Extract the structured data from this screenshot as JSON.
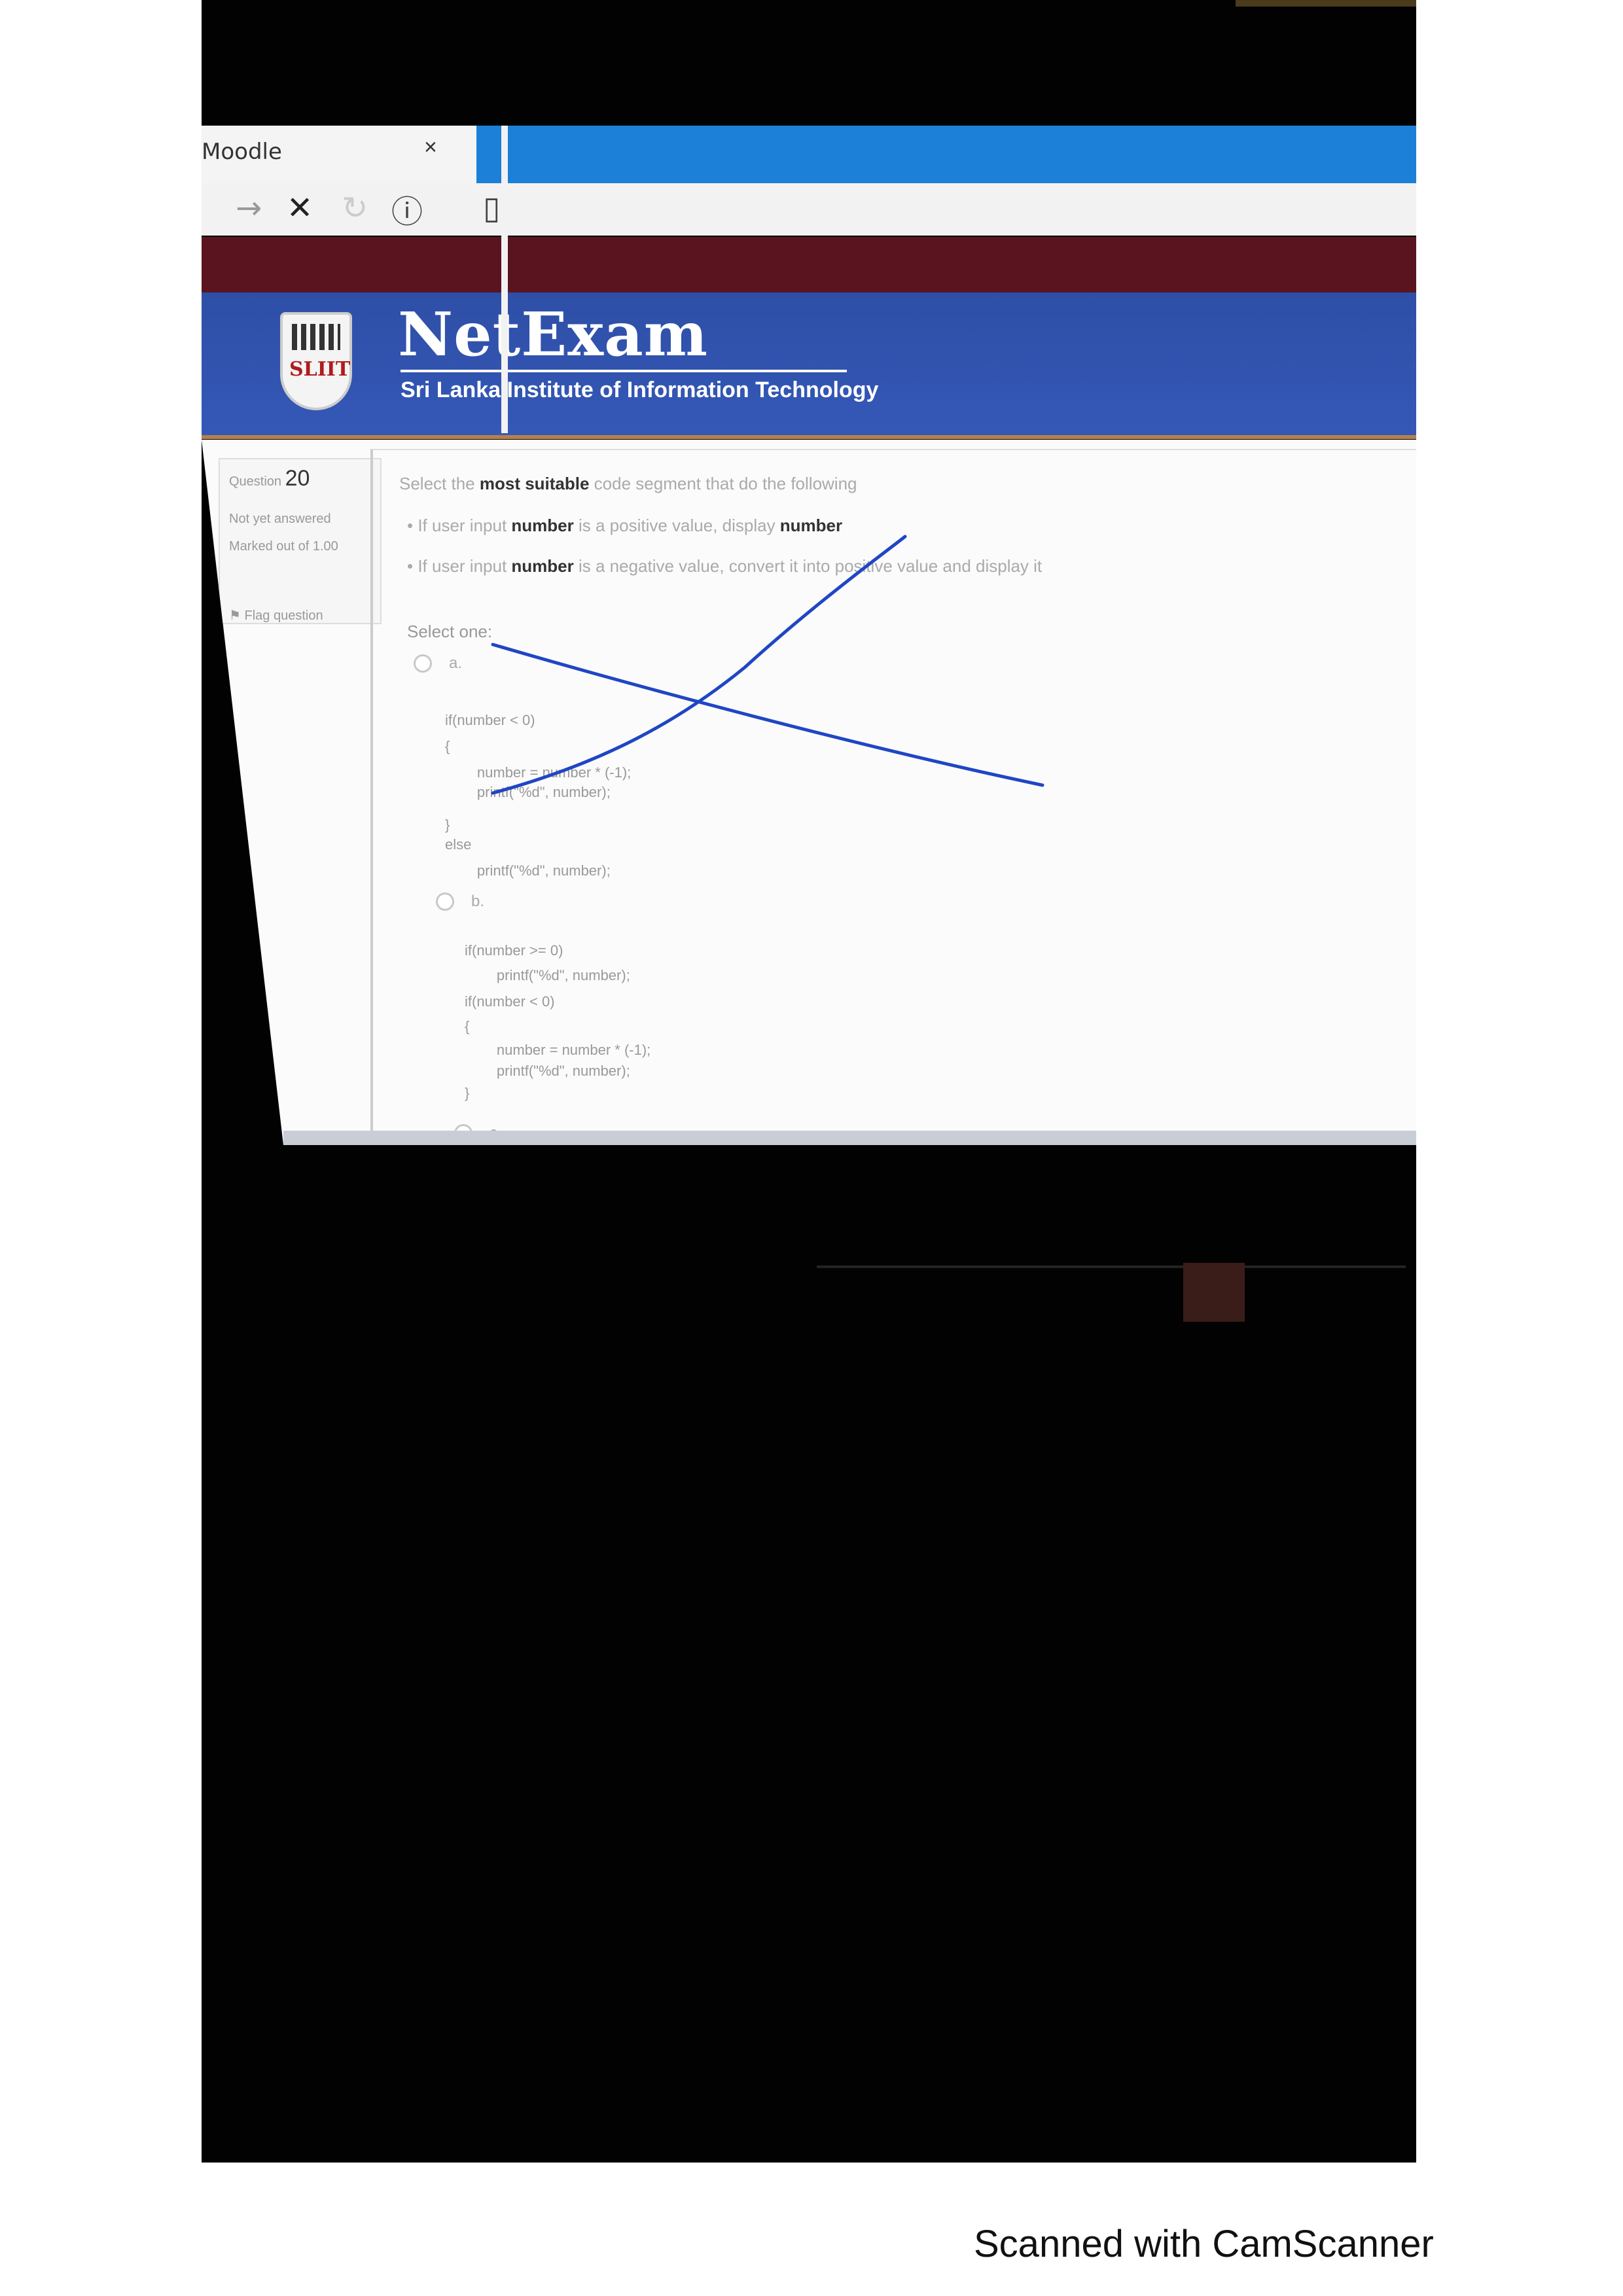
{
  "browser": {
    "tab_title": "Moodle",
    "tab_close": "×",
    "toolbar_icons": [
      "forward-icon",
      "stop-icon",
      "reload-icon",
      "info-icon",
      "reader-icon"
    ]
  },
  "header": {
    "title": "NetExam",
    "subtitle": "Sri Lanka Institute of Information Technology",
    "logo_text": "SLIIT"
  },
  "question_info": {
    "label": "Question",
    "number": "20",
    "state": "Not yet answered",
    "marks": "Marked out of 1.00",
    "flag": "Flag question"
  },
  "question": {
    "prompt_pre": "Select the ",
    "prompt_bold": "most suitable",
    "prompt_post": " code segment that do the following",
    "bullets": [
      {
        "pre": "If user input ",
        "bold": "number",
        "mid": " is a positive value, display ",
        "bold2": "number",
        "post": ""
      },
      {
        "pre": "If user input ",
        "bold": "number",
        "mid": " is a negative value, convert it into positive value and display it",
        "bold2": "",
        "post": ""
      }
    ],
    "select_one": "Select one:",
    "options": [
      {
        "letter": "a.",
        "code": [
          "if(number < 0)",
          "{",
          "        number = number * (-1);",
          "        printf(\"%d\", number);",
          "}",
          "else",
          "        printf(\"%d\", number);"
        ]
      },
      {
        "letter": "b.",
        "code": [
          "if(number >= 0)",
          "        printf(\"%d\", number);",
          "if(number < 0)",
          "{",
          "        number = number * (-1);",
          "        printf(\"%d\", number);",
          "}"
        ]
      },
      {
        "letter": "c.",
        "code": []
      }
    ]
  },
  "footer": {
    "text": "Scanned with CamScanner"
  },
  "colors": {
    "banner": "#3558b8",
    "maroon": "#5a1420",
    "tab_strip": "#1c7fd8",
    "pen": "#1f46c4"
  }
}
